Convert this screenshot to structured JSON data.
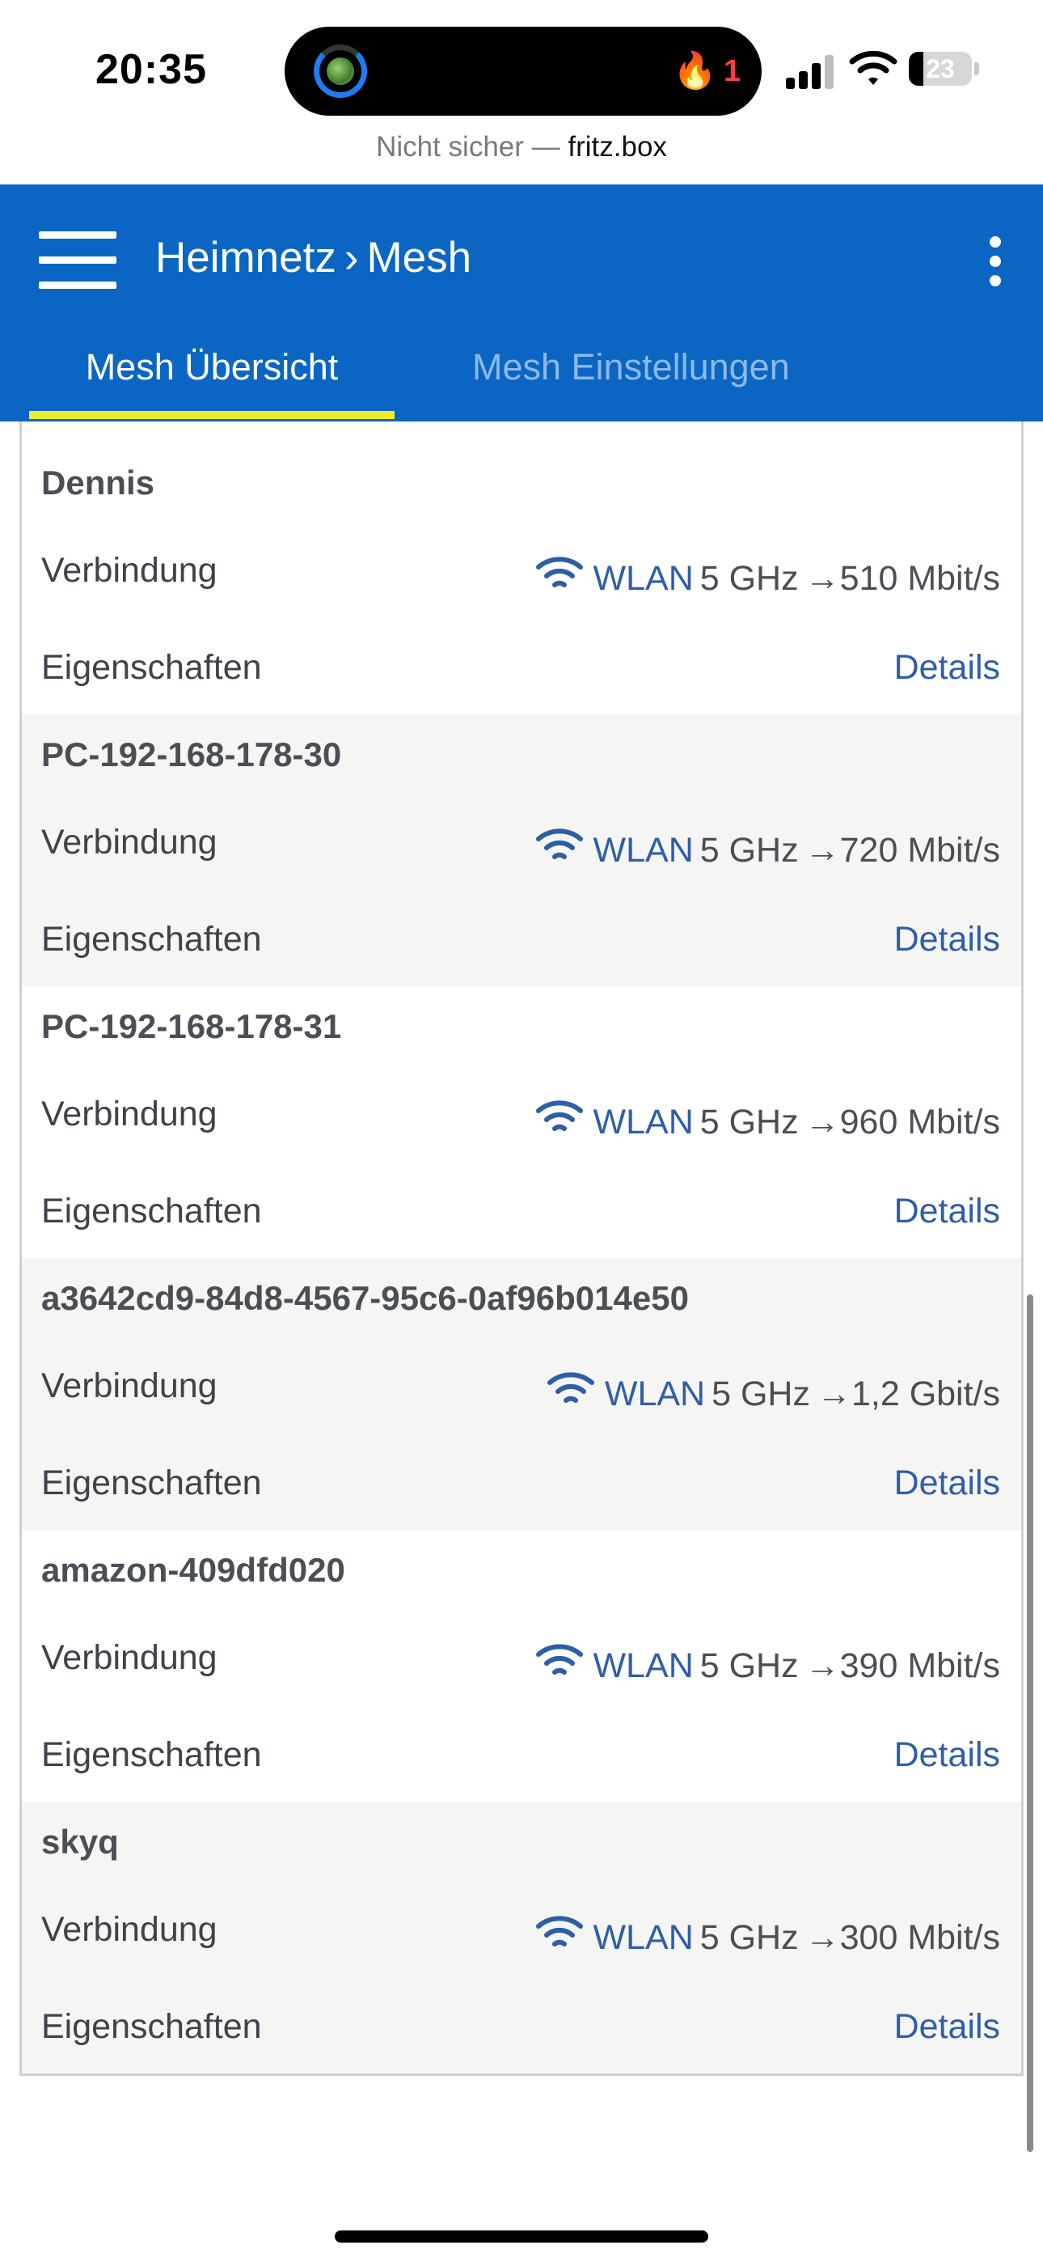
{
  "status_bar": {
    "time": "20:35",
    "notification_count": "1",
    "battery_percent": "23",
    "battery_level": 0.23
  },
  "browser": {
    "security_text": "Nicht sicher —",
    "host": "fritz.box"
  },
  "header": {
    "breadcrumb_parent": "Heimnetz",
    "breadcrumb_current": "Mesh",
    "tabs": [
      {
        "label": "Mesh Übersicht",
        "active": true
      },
      {
        "label": "Mesh Einstellungen",
        "active": false
      }
    ],
    "accent_color": "#0a66c2",
    "tab_indicator_color": "#f4ec2a"
  },
  "row_labels": {
    "connection": "Verbindung",
    "properties": "Eigenschaften",
    "details_link": "Details"
  },
  "devices": [
    {
      "name": "Dennis",
      "conn_type": "WLAN",
      "band": "5 GHz",
      "speed": "→510 Mbit/s"
    },
    {
      "name": "PC-192-168-178-30",
      "conn_type": "WLAN",
      "band": "5 GHz",
      "speed": "→720 Mbit/s"
    },
    {
      "name": "PC-192-168-178-31",
      "conn_type": "WLAN",
      "band": "5 GHz",
      "speed": "→960 Mbit/s"
    },
    {
      "name": "a3642cd9-84d8-4567-95c6-0af96b014e50",
      "conn_type": "WLAN",
      "band": "5 GHz",
      "speed": "→1,2 Gbit/s"
    },
    {
      "name": "amazon-409dfd020",
      "conn_type": "WLAN",
      "band": "5 GHz",
      "speed": "→390 Mbit/s"
    },
    {
      "name": "skyq",
      "conn_type": "WLAN",
      "band": "5 GHz",
      "speed": "→300 Mbit/s"
    }
  ]
}
